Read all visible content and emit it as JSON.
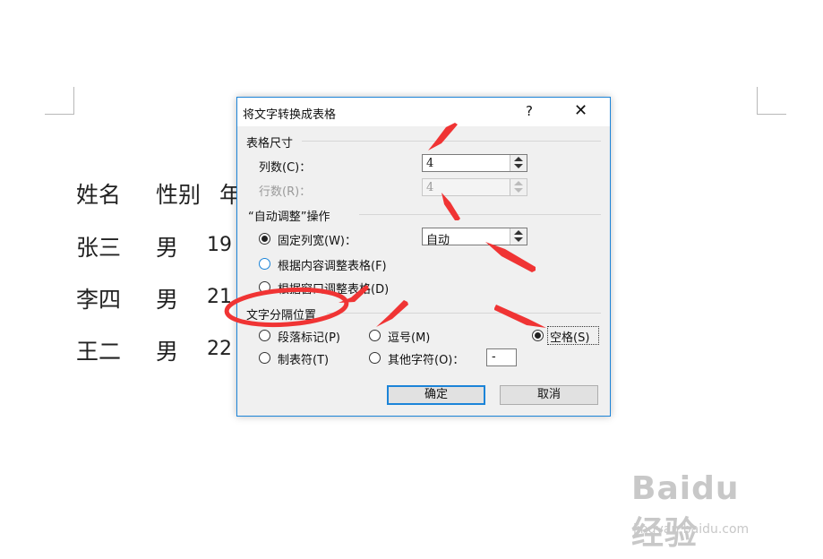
{
  "document": {
    "rows": [
      [
        "姓名",
        "性别",
        "年"
      ],
      [
        "张三",
        "男",
        "19"
      ],
      [
        "李四",
        "男",
        "21"
      ],
      [
        "王二",
        "男",
        "22"
      ]
    ]
  },
  "dialog": {
    "title": "将文字转换成表格",
    "help_label": "?",
    "close_label": "✕",
    "table_size": {
      "heading": "表格尺寸",
      "columns_label": "列数(C)：",
      "columns_value": "4",
      "rows_label": "行数(R)：",
      "rows_value": "4"
    },
    "autofit": {
      "heading": "“自动调整”操作",
      "fixed_label": "固定列宽(W)：",
      "fixed_value": "自动",
      "content_label": "根据内容调整表格(F)",
      "window_label": "根据窗口调整表格(D)"
    },
    "separator": {
      "heading": "文字分隔位置",
      "paragraph_label": "段落标记(P)",
      "comma_label": "逗号(M)",
      "space_label": "空格(S)",
      "tab_label": "制表符(T)",
      "other_label": "其他字符(O)：",
      "other_value": "-",
      "selected": "space"
    },
    "ok_label": "确定",
    "cancel_label": "取消"
  },
  "watermark": {
    "logo": "Baidu经验",
    "url": "jingyan.baidu.com"
  },
  "colors": {
    "accent": "#1c84d8",
    "annotation": "#f03434"
  }
}
